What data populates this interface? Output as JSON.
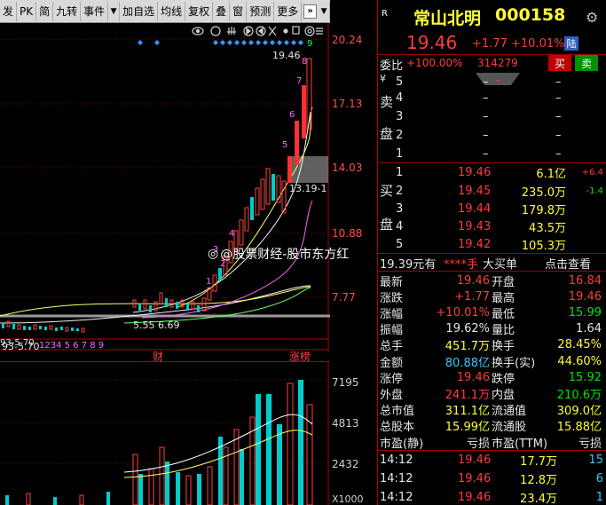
{
  "toolbar": {
    "items": [
      "发",
      "PK",
      "简",
      "九转",
      "事件",
      "加自选",
      "均线",
      "复权",
      "叠",
      "窗",
      "预测",
      "更多"
    ]
  },
  "chart": {
    "price_axis": [
      "20.24",
      "17.13",
      "14.03",
      "10.88",
      "7.77"
    ],
    "volume_axis": [
      "7195",
      "4813",
      "2432",
      "X1000"
    ],
    "high_marker": "19.46",
    "low_marker": "13.19-1",
    "low_annotation": "5.55 6.69",
    "bottom_marker": "93-5.70",
    "td_counts_bottom": "1234 5 6 7 8 9",
    "td_counts_top": [
      "1",
      "2",
      "3",
      "4",
      "5",
      "6",
      "7",
      "8",
      "9"
    ],
    "event_labels": [
      "财",
      "涨榜"
    ],
    "toolbar_icons": [
      "eye-icon",
      "circle-icon",
      "hand-icon",
      "play-icon",
      "arrow-left-icon",
      "arrow-right-icon",
      "scissors-icon",
      "dot-icon",
      "copy-icon",
      "ring-icon",
      "stack-icon"
    ]
  },
  "watermark": "@股票财经-股市东方红",
  "stock": {
    "badge": "R",
    "name": "常山北明",
    "code": "000158",
    "price": "19.46",
    "change": "+1.77",
    "change_pct": "+10.01%",
    "tag": "陆"
  },
  "order_ratio": {
    "label": "委比",
    "value": "+100.00%",
    "diff": "314279",
    "buy_btn": "买",
    "sell_btn": "卖"
  },
  "sell_book": {
    "side_label": [
      "卖",
      "盘"
    ],
    "prefix": "¥",
    "levels": [
      {
        "lvl": "5",
        "price": "–",
        "vol": "–"
      },
      {
        "lvl": "4",
        "price": "–",
        "vol": "–"
      },
      {
        "lvl": "3",
        "price": "–",
        "vol": "–"
      },
      {
        "lvl": "2",
        "price": "–",
        "vol": "–"
      },
      {
        "lvl": "1",
        "price": "–",
        "vol": "–"
      }
    ]
  },
  "buy_book": {
    "side_label": [
      "买",
      "盘"
    ],
    "levels": [
      {
        "lvl": "1",
        "price": "19.46",
        "vol": "6.1亿",
        "chg": "+6.4"
      },
      {
        "lvl": "2",
        "price": "19.45",
        "vol": "235.0万",
        "chg": "-1.4"
      },
      {
        "lvl": "3",
        "price": "19.44",
        "vol": "179.8万",
        "chg": ""
      },
      {
        "lvl": "4",
        "price": "19.43",
        "vol": "43.5万",
        "chg": ""
      },
      {
        "lvl": "5",
        "price": "19.42",
        "vol": "105.3万",
        "chg": ""
      }
    ]
  },
  "big_order": {
    "price": "19.39元有",
    "stars": "****手",
    "text": "大买单",
    "link": "点击查看"
  },
  "stats": [
    {
      "l1": "最新",
      "v1": "19.46",
      "c1": "red",
      "l2": "开盘",
      "v2": "16.84",
      "c2": "red"
    },
    {
      "l1": "涨跌",
      "v1": "+1.77",
      "c1": "red",
      "l2": "最高",
      "v2": "19.46",
      "c2": "red"
    },
    {
      "l1": "涨幅",
      "v1": "+10.01%",
      "c1": "red",
      "l2": "最低",
      "v2": "15.99",
      "c2": "green"
    },
    {
      "l1": "振幅",
      "v1": "19.62%",
      "c1": "white",
      "l2": "量比",
      "v2": "1.64",
      "c2": "white"
    },
    {
      "l1": "总手",
      "v1": "451.7万",
      "c1": "yellow",
      "l2": "换手",
      "v2": "28.45%",
      "c2": "yellow"
    },
    {
      "l1": "金额",
      "v1": "80.88亿",
      "c1": "cyan",
      "l2": "换手(实)",
      "v2": "44.60%",
      "c2": "yellow"
    },
    {
      "l1": "涨停",
      "v1": "19.46",
      "c1": "red",
      "l2": "跌停",
      "v2": "15.92",
      "c2": "green"
    },
    {
      "l1": "外盘",
      "v1": "241.1万",
      "c1": "red",
      "l2": "内盘",
      "v2": "210.6万",
      "c2": "green"
    },
    {
      "l1": "总市值",
      "v1": "311.1亿",
      "c1": "yellow",
      "l2": "流通值",
      "v2": "309.0亿",
      "c2": "yellow"
    },
    {
      "l1": "总股本",
      "v1": "15.99亿",
      "c1": "yellow",
      "l2": "流通股",
      "v2": "15.88亿",
      "c2": "yellow"
    },
    {
      "l1": "市盈(静)",
      "v1": "亏损",
      "c1": "white",
      "l2": "市盈(TTM)",
      "v2": "亏损",
      "c2": "white"
    }
  ],
  "ticks": [
    {
      "time": "14:12",
      "price": "19.46",
      "vol": "17.7万",
      "n": "15"
    },
    {
      "time": "14:12",
      "price": "19.46",
      "vol": "12.8万",
      "n": "6"
    },
    {
      "time": "14:12",
      "price": "19.46",
      "vol": "23.4万",
      "n": "1"
    }
  ]
}
